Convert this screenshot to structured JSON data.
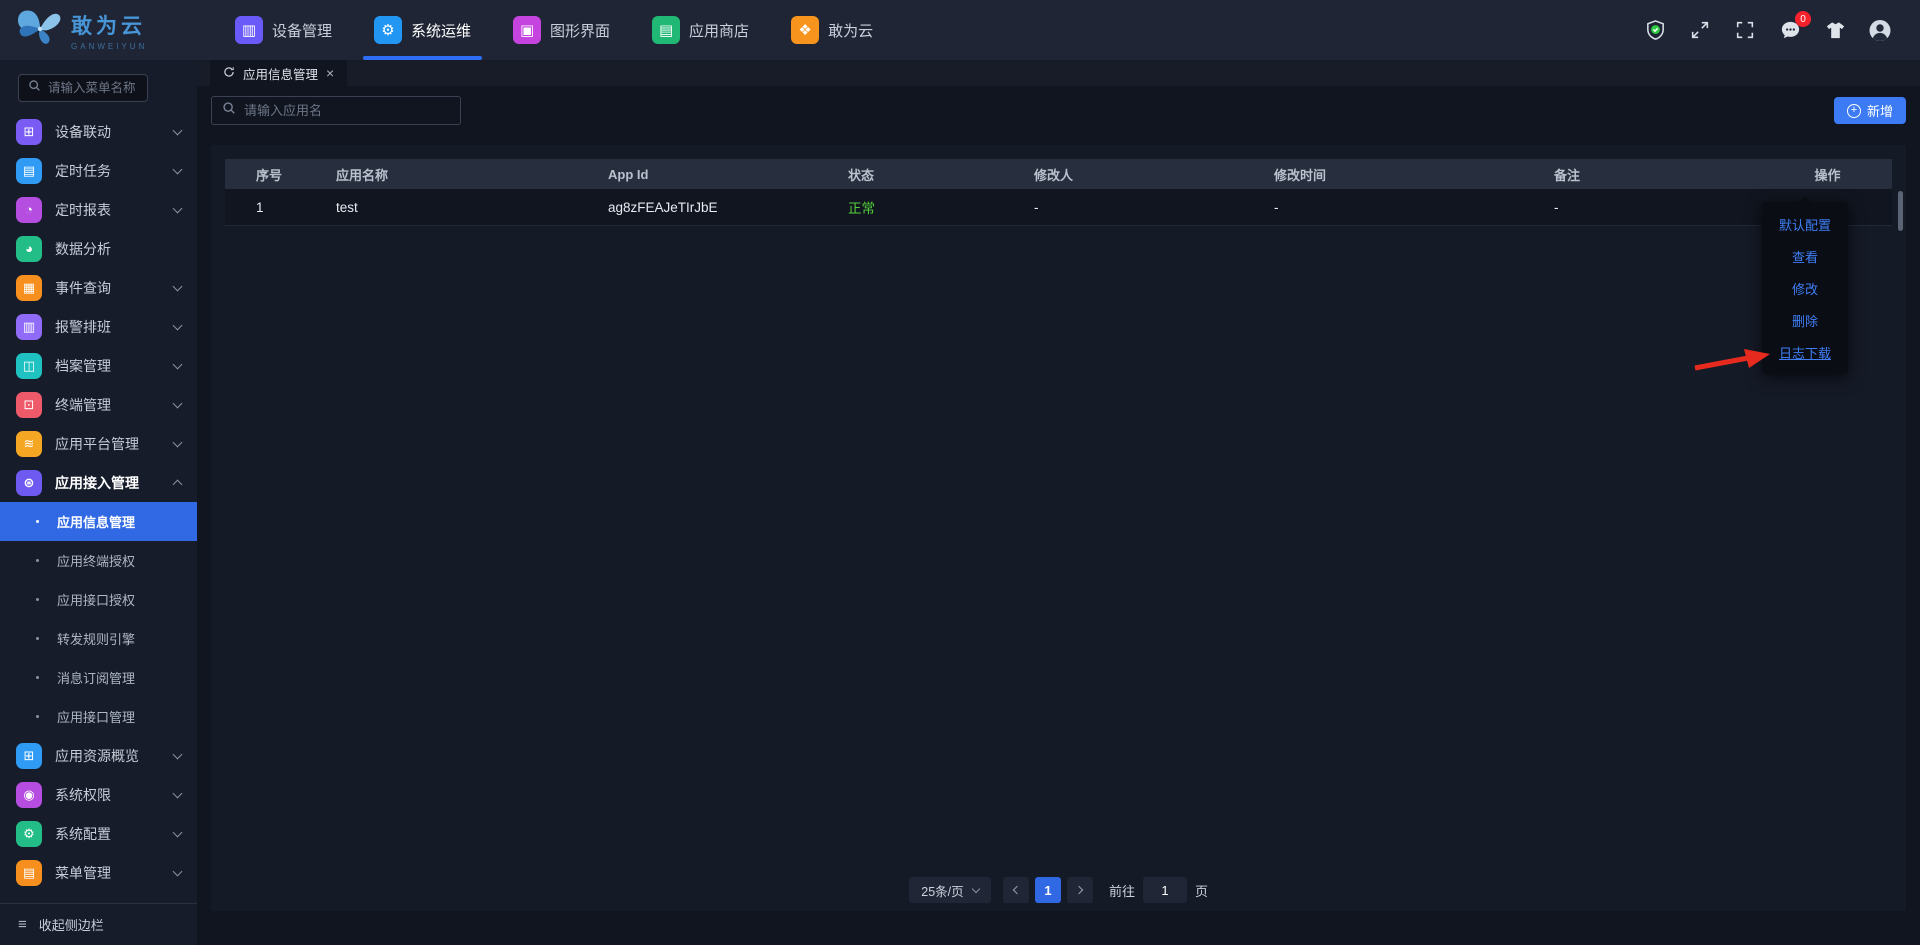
{
  "brand": {
    "name": "敢为云",
    "subtitle": "GANWEIYUN",
    "logo_icon": "butterfly-logo-icon"
  },
  "topnav": {
    "tabs": [
      {
        "label": "设备管理",
        "icon": "device-management-icon",
        "color": "#6a5af9",
        "active": false
      },
      {
        "label": "系统运维",
        "icon": "system-ops-icon",
        "color": "#2196f3",
        "active": true
      },
      {
        "label": "图形界面",
        "icon": "graphic-ui-icon",
        "color": "#c544e0",
        "active": false
      },
      {
        "label": "应用商店",
        "icon": "app-store-icon",
        "color": "#21b875",
        "active": false
      },
      {
        "label": "敢为云",
        "icon": "ganwei-cloud-icon",
        "color": "#f7941d",
        "active": false
      }
    ],
    "right_icons": [
      "security-shield-icon",
      "fullscreen-expand-icon",
      "fullscreen-frame-icon",
      "messages-icon",
      "theme-shirt-icon",
      "user-avatar"
    ],
    "message_badge": "0"
  },
  "sidebar": {
    "search_placeholder": "请输入菜单名称",
    "items": [
      {
        "label": "设备联动",
        "color": "#7a5cf5",
        "has_children": true
      },
      {
        "label": "定时任务",
        "color": "#2f9bf5",
        "has_children": true
      },
      {
        "label": "定时报表",
        "color": "#b44de0",
        "has_children": true
      },
      {
        "label": "数据分析",
        "color": "#23bd87",
        "has_children": false
      },
      {
        "label": "事件查询",
        "color": "#f78f1e",
        "has_children": true
      },
      {
        "label": "报警排班",
        "color": "#8f6bf7",
        "has_children": true
      },
      {
        "label": "档案管理",
        "color": "#1fc1c1",
        "has_children": true
      },
      {
        "label": "终端管理",
        "color": "#ee5a6a",
        "has_children": true
      },
      {
        "label": "应用平台管理",
        "color": "#f5a623",
        "has_children": true
      },
      {
        "label": "应用接入管理",
        "color": "#6e5af0",
        "has_children": true,
        "expanded": true,
        "children": [
          {
            "label": "应用信息管理",
            "active": true
          },
          {
            "label": "应用终端授权",
            "active": false
          },
          {
            "label": "应用接口授权",
            "active": false
          },
          {
            "label": "转发规则引擎",
            "active": false
          },
          {
            "label": "消息订阅管理",
            "active": false
          },
          {
            "label": "应用接口管理",
            "active": false
          }
        ]
      },
      {
        "label": "应用资源概览",
        "color": "#2f9bf5",
        "has_children": true
      },
      {
        "label": "系统权限",
        "color": "#b44de0",
        "has_children": true
      },
      {
        "label": "系统配置",
        "color": "#23bd87",
        "has_children": true
      },
      {
        "label": "菜单管理",
        "color": "#f78f1e",
        "has_children": true
      }
    ],
    "collapse_label": "收起侧边栏"
  },
  "tabbar": {
    "tabs": [
      {
        "label": "应用信息管理",
        "icons": [
          "refresh-icon",
          "close-icon"
        ]
      }
    ]
  },
  "content": {
    "search_placeholder": "请输入应用名",
    "add_button_label": "新增",
    "table": {
      "columns": [
        "序号",
        "应用名称",
        "App Id",
        "状态",
        "修改人",
        "修改时间",
        "备注",
        "操作"
      ],
      "rows": [
        {
          "index": "1",
          "name": "test",
          "app_id": "ag8zFEAJeTIrJbE",
          "status": "正常",
          "modified_by": "-",
          "modified_time": "-",
          "remark": "-"
        }
      ]
    },
    "row_action_menu": {
      "items": [
        "默认配置",
        "查看",
        "修改",
        "删除",
        "日志下载"
      ],
      "highlighted": "日志下载"
    },
    "pagination": {
      "page_size": "25条/页",
      "current_page": "1",
      "goto_label": "前往",
      "goto_value": "1",
      "page_unit": "页"
    }
  },
  "colors": {
    "accent_blue": "#2e6ef5",
    "active_menu_blue": "#3069e3",
    "success_green": "#55cf3a",
    "menu_link_blue": "#3f7ef7",
    "badge_red": "#f5222d",
    "annotation_arrow_red": "#e62b1e",
    "topbar_bg": "#1f2534",
    "sidebar_bg": "#171c2a",
    "panel_bg": "#151a27",
    "table_header_bg": "#272e3e"
  }
}
